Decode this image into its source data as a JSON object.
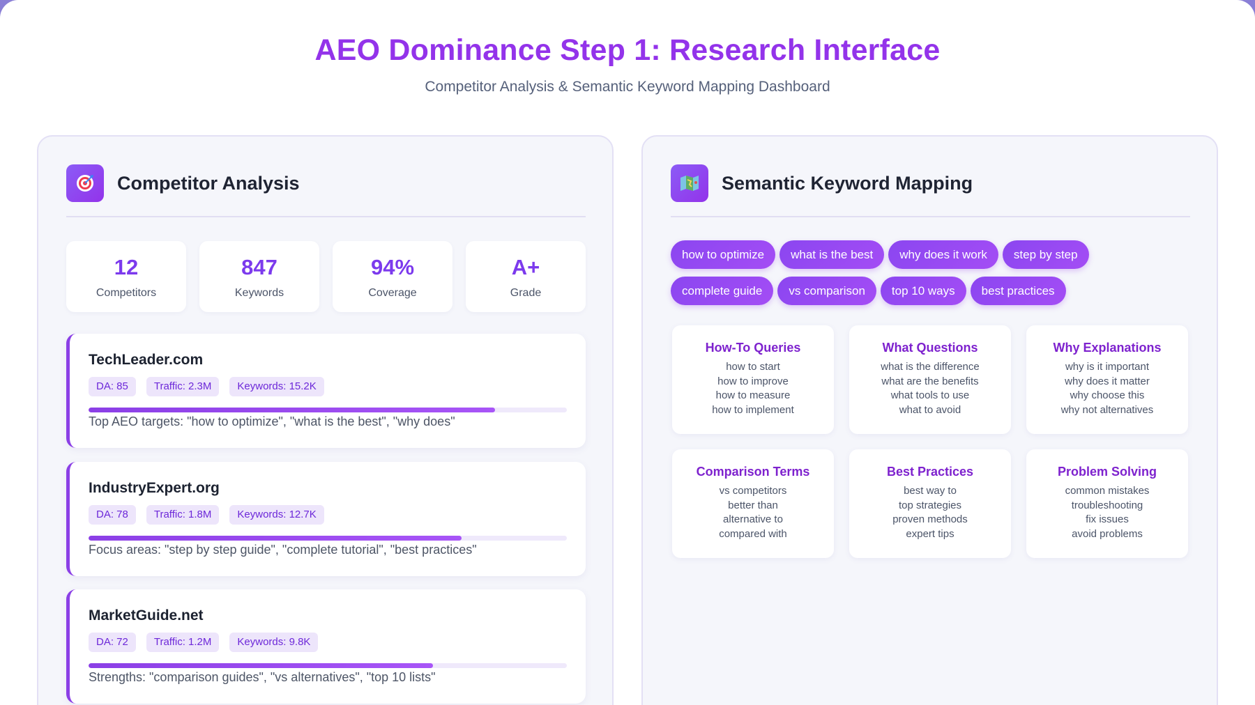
{
  "header": {
    "title": "AEO Dominance Step 1: Research Interface",
    "subtitle": "Competitor Analysis & Semantic Keyword Mapping Dashboard"
  },
  "competitor_panel": {
    "title": "Competitor Analysis",
    "icon": "target-icon",
    "stats": [
      {
        "value": "12",
        "label": "Competitors"
      },
      {
        "value": "847",
        "label": "Keywords"
      },
      {
        "value": "94%",
        "label": "Coverage"
      },
      {
        "value": "A+",
        "label": "Grade"
      }
    ],
    "competitors": [
      {
        "name": "TechLeader.com",
        "da": "DA: 85",
        "traffic": "Traffic: 2.3M",
        "keywords": "Keywords: 15.2K",
        "progress": 0.85,
        "note": "Top AEO targets: \"how to optimize\", \"what is the best\", \"why does\""
      },
      {
        "name": "IndustryExpert.org",
        "da": "DA: 78",
        "traffic": "Traffic: 1.8M",
        "keywords": "Keywords: 12.7K",
        "progress": 0.78,
        "note": "Focus areas: \"step by step guide\", \"complete tutorial\", \"best practices\""
      },
      {
        "name": "MarketGuide.net",
        "da": "DA: 72",
        "traffic": "Traffic: 1.2M",
        "keywords": "Keywords: 9.8K",
        "progress": 0.72,
        "note": "Strengths: \"comparison guides\", \"vs alternatives\", \"top 10 lists\""
      }
    ]
  },
  "keyword_panel": {
    "title": "Semantic Keyword Mapping",
    "icon": "map-icon",
    "tags_row1": [
      "how to optimize",
      "what is the best",
      "why does it work",
      "step by step"
    ],
    "tags_row2": [
      "complete guide",
      "vs comparison",
      "top 10 ways",
      "best practices"
    ],
    "categories": [
      {
        "title": "How-To Queries",
        "items": [
          "how to start",
          "how to improve",
          "how to measure",
          "how to implement"
        ]
      },
      {
        "title": "What Questions",
        "items": [
          "what is the difference",
          "what are the benefits",
          "what tools to use",
          "what to avoid"
        ]
      },
      {
        "title": "Why Explanations",
        "items": [
          "why is it important",
          "why does it matter",
          "why choose this",
          "why not alternatives"
        ]
      },
      {
        "title": "Comparison Terms",
        "items": [
          "vs competitors",
          "better than",
          "alternative to",
          "compared with"
        ]
      },
      {
        "title": "Best Practices",
        "items": [
          "best way to",
          "top strategies",
          "proven methods",
          "expert tips"
        ]
      },
      {
        "title": "Problem Solving",
        "items": [
          "common mistakes",
          "troubleshooting",
          "fix issues",
          "avoid problems"
        ]
      }
    ]
  }
}
